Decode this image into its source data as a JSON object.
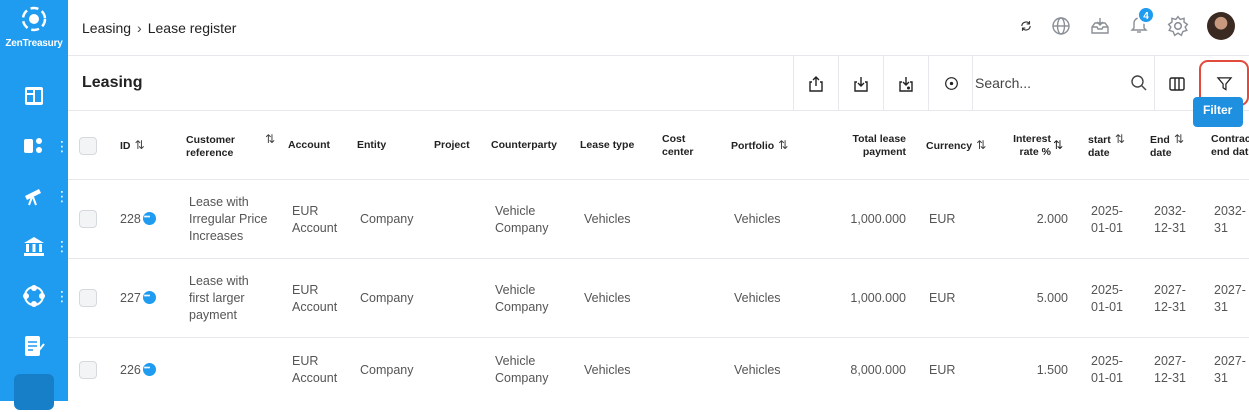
{
  "app": {
    "brand": "ZenTreasury"
  },
  "header": {
    "breadcrumb": [
      "Leasing",
      "Lease register"
    ],
    "notification_count": "4",
    "icons": [
      "refresh-icon",
      "globe-icon",
      "download-tray-icon",
      "bell-icon",
      "gear-icon",
      "avatar"
    ]
  },
  "toolbar": {
    "title": "Leasing",
    "search_placeholder": "Search...",
    "tooltip": "Filter",
    "tools": [
      "export-icon",
      "download-icon",
      "import-icon",
      "add-circle-icon",
      "search-icon",
      "columns-icon",
      "filter-icon"
    ]
  },
  "sidebar": {
    "items": [
      "dashboard-icon",
      "modules-icon",
      "telescope-icon",
      "bank-icon",
      "network-icon",
      "report-icon",
      "key-icon"
    ]
  },
  "table": {
    "headers": [
      {
        "label1": "ID",
        "label2": ""
      },
      {
        "label1": "Customer",
        "label2": "reference"
      },
      {
        "label1": "Account",
        "label2": ""
      },
      {
        "label1": "Entity",
        "label2": ""
      },
      {
        "label1": "Project",
        "label2": ""
      },
      {
        "label1": "Counterparty",
        "label2": ""
      },
      {
        "label1": "Lease type",
        "label2": ""
      },
      {
        "label1": "Cost",
        "label2": "center"
      },
      {
        "label1": "Portfolio",
        "label2": ""
      },
      {
        "label1": "Total lease",
        "label2": "payment"
      },
      {
        "label1": "Currency",
        "label2": ""
      },
      {
        "label1": "Interest",
        "label2": "rate %"
      },
      {
        "label1": "start",
        "label2": "date"
      },
      {
        "label1": "End",
        "label2": "date"
      },
      {
        "label1": "Contrac",
        "label2": "end dat"
      }
    ],
    "rows": [
      {
        "id": "228",
        "ref1": "Lease with",
        "ref2": "Irregular Price",
        "ref3": "Increases",
        "acc1": "EUR",
        "acc2": "Account",
        "entity": "Company",
        "cp1": "Vehicle",
        "cp2": "Company",
        "lease_type": "Vehicles",
        "portfolio": "Vehicles",
        "total": "1,000.000",
        "currency": "EUR",
        "rate": "2.000",
        "start1": "2025-",
        "start2": "01-01",
        "end1": "2032-",
        "end2": "12-31",
        "cend1": "2032-",
        "cend2": "31"
      },
      {
        "id": "227",
        "ref1": "Lease with",
        "ref2": "first larger",
        "ref3": "payment",
        "acc1": "EUR",
        "acc2": "Account",
        "entity": "Company",
        "cp1": "Vehicle",
        "cp2": "Company",
        "lease_type": "Vehicles",
        "portfolio": "Vehicles",
        "total": "1,000.000",
        "currency": "EUR",
        "rate": "5.000",
        "start1": "2025-",
        "start2": "01-01",
        "end1": "2027-",
        "end2": "12-31",
        "cend1": "2027-",
        "cend2": "31"
      },
      {
        "id": "226",
        "ref1": "",
        "ref2": "",
        "ref3": "",
        "acc1": "EUR",
        "acc2": "Account",
        "entity": "Company",
        "cp1": "Vehicle",
        "cp2": "Company",
        "lease_type": "Vehicles",
        "portfolio": "Vehicles",
        "total": "8,000.000",
        "currency": "EUR",
        "rate": "1.500",
        "start1": "2025-",
        "start2": "01-01",
        "end1": "2027-",
        "end2": "12-31",
        "cend1": "2027-",
        "cend2": "31"
      }
    ]
  }
}
